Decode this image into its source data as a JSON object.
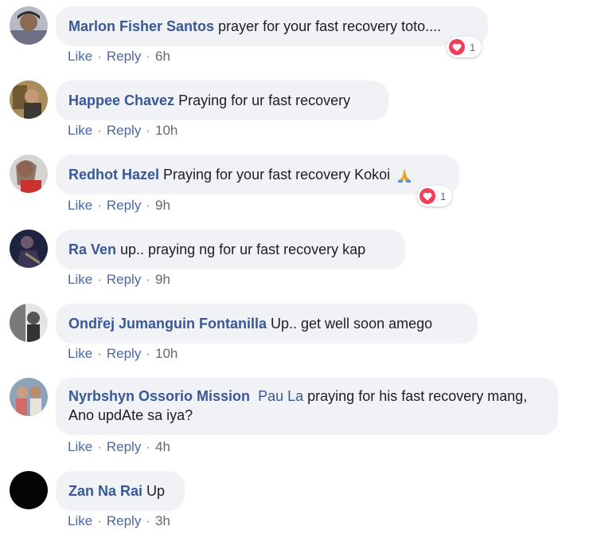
{
  "actions": {
    "like": "Like",
    "reply": "Reply",
    "separator": "·"
  },
  "comments": [
    {
      "author": "Marlon Fisher Santos",
      "text": "prayer for your fast recovery toto....",
      "time": "6h",
      "reactions": 1
    },
    {
      "author": "Happee Chavez",
      "text": "Praying for ur fast recovery",
      "time": "10h"
    },
    {
      "author": "Redhot Hazel",
      "text": "Praying for your fast recovery Kokoi",
      "emoji": "praying-hands-icon",
      "time": "9h",
      "reactions": 1
    },
    {
      "author": "Ra Ven",
      "text": "up.. praying ng for ur fast recovery kap",
      "time": "9h"
    },
    {
      "author": "Ondřej Jumanguin Fontanilla",
      "text": "Up.. get well soon amego",
      "time": "10h"
    },
    {
      "author": "Nyrbshyn Ossorio Mission",
      "mention": "Pau La",
      "text": "praying for his fast recovery mang, Ano updAte sa iya?",
      "time": "4h"
    },
    {
      "author": "Zan Na Rai",
      "text": "Up",
      "time": "3h"
    }
  ],
  "colors": {
    "author": "#385898",
    "bubble": "#f0f2f5",
    "action_link": "#4b67a1",
    "heart": "#f33e58"
  }
}
